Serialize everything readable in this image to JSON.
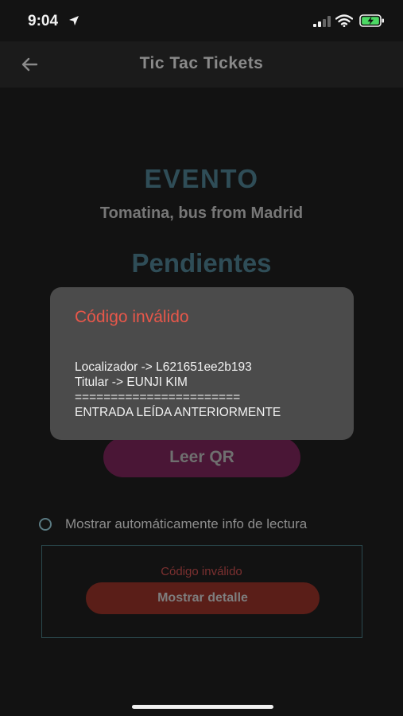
{
  "status_bar": {
    "time": "9:04"
  },
  "app_bar": {
    "title": "Tic Tac Tickets"
  },
  "event": {
    "heading": "EVENTO",
    "name": "Tomatina, bus from Madrid"
  },
  "pending": {
    "heading": "Pendientes"
  },
  "read_qr_button": {
    "label": "Leer QR"
  },
  "auto_info": {
    "label": "Mostrar automáticamente info de lectura",
    "checked": false
  },
  "result": {
    "status": "Código inválido",
    "detail_button": "Mostrar detalle"
  },
  "dialog": {
    "title": "Código inválido",
    "lines": [
      "Localizador -> L621651ee2b193",
      "Titular -> EUNJI KIM",
      "=======================",
      "ENTRADA LEÍDA ANTERIORMENTE"
    ]
  },
  "colors": {
    "accent_teal": "#2f4d57",
    "error_red": "#e8574a",
    "qr_button": "#4a1636",
    "detail_button": "#5a1e18"
  }
}
